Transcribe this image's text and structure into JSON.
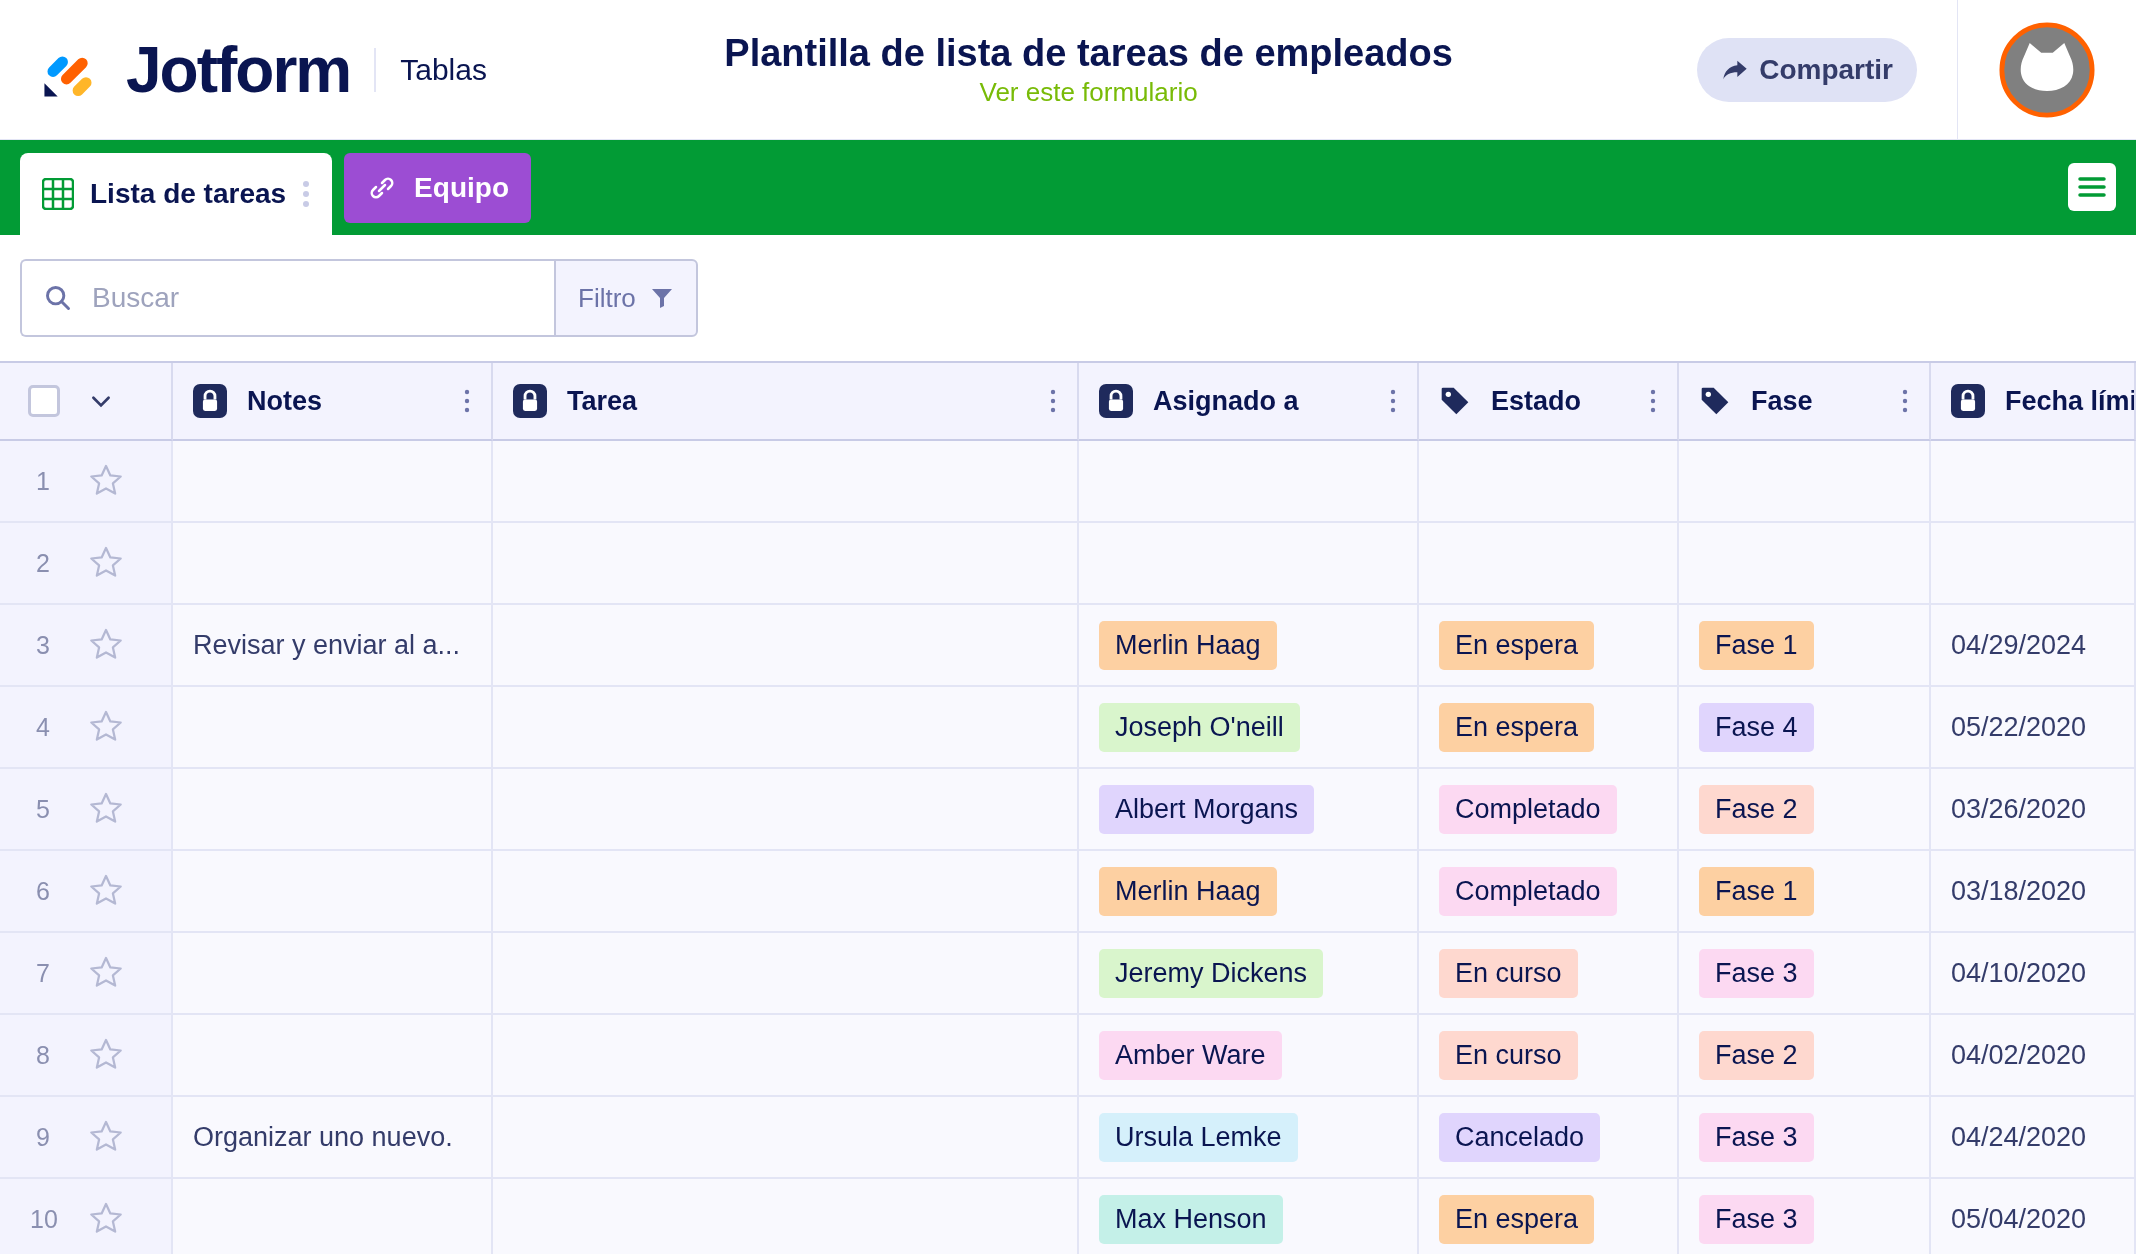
{
  "header": {
    "brand": "Jotform",
    "section": "Tablas",
    "title": "Plantilla de lista de tareas de empleados",
    "subtitle_link": "Ver este formulario",
    "share_button": "Compartir"
  },
  "tabs": [
    {
      "label": "Lista de tareas",
      "kind": "table",
      "selected": true
    },
    {
      "label": "Equipo",
      "kind": "link",
      "selected": false
    }
  ],
  "search": {
    "placeholder": "Buscar",
    "filter_button": "Filtro"
  },
  "table": {
    "select_all_checked": false,
    "columns": [
      {
        "label": "Notes",
        "kind": "lock"
      },
      {
        "label": "Tarea",
        "kind": "lock"
      },
      {
        "label": "Asignado a",
        "kind": "lock"
      },
      {
        "label": "Estado",
        "kind": "tag"
      },
      {
        "label": "Fase",
        "kind": "tag"
      },
      {
        "label": "Fecha lími",
        "kind": "lock"
      }
    ],
    "rows": [
      {
        "number": "1",
        "starred": false
      },
      {
        "number": "2",
        "starred": false
      },
      {
        "number": "3",
        "starred": false,
        "notes": "Revisar y enviar al a...",
        "assignee": {
          "text": "Merlin Haag",
          "color": "#fdd0a2"
        },
        "status": {
          "text": "En espera",
          "color": "#fdd0a2"
        },
        "phase": {
          "text": "Fase 1",
          "color": "#fdd0a2"
        },
        "date": "04/29/2024"
      },
      {
        "number": "4",
        "starred": false,
        "assignee": {
          "text": "Joseph O'neill",
          "color": "#d9f5cc"
        },
        "status": {
          "text": "En espera",
          "color": "#fdd0a2"
        },
        "phase": {
          "text": "Fase 4",
          "color": "#e0d5fd"
        },
        "date": "05/22/2020"
      },
      {
        "number": "5",
        "starred": false,
        "assignee": {
          "text": "Albert Morgans",
          "color": "#e0d5fd"
        },
        "status": {
          "text": "Completado",
          "color": "#fcd9f2"
        },
        "phase": {
          "text": "Fase 2",
          "color": "#fed8cf"
        },
        "date": "03/26/2020"
      },
      {
        "number": "6",
        "starred": false,
        "assignee": {
          "text": "Merlin Haag",
          "color": "#fdd0a2"
        },
        "status": {
          "text": "Completado",
          "color": "#fcd9f2"
        },
        "phase": {
          "text": "Fase 1",
          "color": "#fdd0a2"
        },
        "date": "03/18/2020"
      },
      {
        "number": "7",
        "starred": false,
        "assignee": {
          "text": "Jeremy Dickens",
          "color": "#d9f5cc"
        },
        "status": {
          "text": "En curso",
          "color": "#fed8cf"
        },
        "phase": {
          "text": "Fase 3",
          "color": "#fcd9f2"
        },
        "date": "04/10/2020"
      },
      {
        "number": "8",
        "starred": false,
        "assignee": {
          "text": "Amber Ware",
          "color": "#fcd9f2"
        },
        "status": {
          "text": "En curso",
          "color": "#fed8cf"
        },
        "phase": {
          "text": "Fase 2",
          "color": "#fed8cf"
        },
        "date": "04/02/2020"
      },
      {
        "number": "9",
        "starred": false,
        "notes": "Organizar uno nuevo.",
        "assignee": {
          "text": "Ursula Lemke",
          "color": "#d5f0fb"
        },
        "status": {
          "text": "Cancelado",
          "color": "#e0d5fd"
        },
        "phase": {
          "text": "Fase 3",
          "color": "#fcd9f2"
        },
        "date": "04/24/2020"
      },
      {
        "number": "10",
        "starred": false,
        "assignee": {
          "text": "Max Henson",
          "color": "#c4f0e8"
        },
        "status": {
          "text": "En espera",
          "color": "#fdd0a2"
        },
        "phase": {
          "text": "Fase 3",
          "color": "#fcd9f2"
        },
        "date": "05/04/2020"
      }
    ]
  }
}
